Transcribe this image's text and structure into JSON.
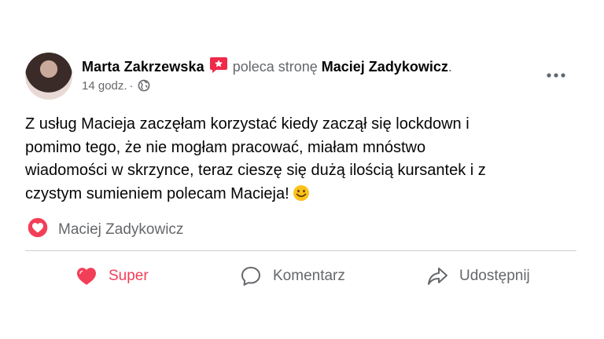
{
  "post": {
    "author": "Marta Zakrzewska",
    "recommends_text": "poleca stronę",
    "page_name": "Maciej Zadykowicz",
    "period": ".",
    "time": "14 godz.",
    "dot": "·",
    "body": "Z usług Macieja zaczęłam korzystać kiedy zaczął się lockdown i\npomimo tego, że nie mogłam pracować, miałam mnóstwo\nwiadomości w skrzynce, teraz cieszę się dużą ilością kursantek i z\nczystym sumieniem polecam Macieja!",
    "emoji": "smiling-face-emoji"
  },
  "reactions": {
    "icon": "heart-icon",
    "name": "Maciej Zadykowicz"
  },
  "actions": {
    "super_label": "Super",
    "comment_label": "Komentarz",
    "share_label": "Udostępnij"
  },
  "colors": {
    "super_red": "#f33e58",
    "recommend_badge": "#f02849",
    "secondary_text": "#65676b",
    "divider": "#ced0d4"
  }
}
